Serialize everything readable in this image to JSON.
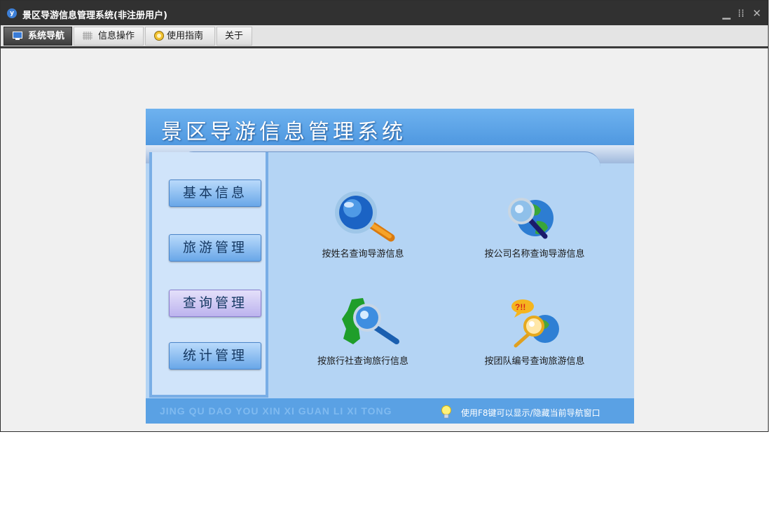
{
  "window": {
    "title": "景区导游信息管理系统(非注册用户)",
    "app_icon": "logo-icon",
    "controls": [
      "minimize-icon",
      "restore-icon",
      "close-icon"
    ]
  },
  "menu": {
    "tabs": [
      {
        "label": "系统导航",
        "icon": "monitor-icon",
        "active": true
      },
      {
        "label": "信息操作",
        "icon": "grid-icon",
        "active": false
      },
      {
        "label": "使用指南",
        "icon": "help-icon",
        "active": false
      },
      {
        "label": "关于",
        "icon": "",
        "active": false
      }
    ]
  },
  "panel": {
    "title": "景区导游信息管理系统",
    "sidebar": [
      {
        "label": "基本信息",
        "selected": false
      },
      {
        "label": "旅游管理",
        "selected": false
      },
      {
        "label": "查询管理",
        "selected": true
      },
      {
        "label": "统计管理",
        "selected": false
      }
    ],
    "features": [
      {
        "label": "按姓名查询导游信息",
        "icon": "magnifier-icon"
      },
      {
        "label": "按公司名称查询导游信息",
        "icon": "globe-search-icon"
      },
      {
        "label": "按旅行社查询旅行信息",
        "icon": "map-search-icon"
      },
      {
        "label": "按团队编号查询旅游信息",
        "icon": "globe-question-icon"
      }
    ],
    "footer": {
      "pinyin": "JING QU DAO YOU XIN XI GUAN LI XI TONG",
      "hint": "使用F8键可以显示/隐藏当前导航窗口",
      "hint_icon": "bulb-icon"
    }
  },
  "colors": {
    "title_bar": "#313131",
    "banner": "#5ba2e6",
    "panel": "#b4d4f4",
    "footer": "#5aa1e4"
  }
}
